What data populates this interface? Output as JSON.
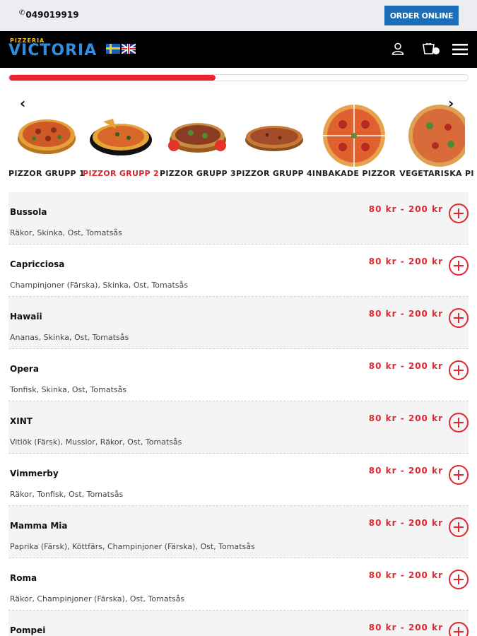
{
  "topbar": {
    "phone_icon": "phone-icon",
    "phone": "049019919",
    "order_online": "ORDER ONLINE"
  },
  "header": {
    "logo_small": "PIZZERIA",
    "logo_big": "VICTORIA",
    "languages": [
      "swedish-flag",
      "uk-flag"
    ],
    "icons": [
      "user-icon",
      "cart-icon",
      "menu-icon"
    ]
  },
  "progress": {
    "value": 0.45,
    "color": "#e8242f"
  },
  "categories": [
    {
      "label": "PIZZOR GRUPP 1",
      "active": false
    },
    {
      "label": "PIZZOR GRUPP 2",
      "active": true
    },
    {
      "label": "PIZZOR GRUPP 3",
      "active": false
    },
    {
      "label": "PIZZOR GRUPP 4",
      "active": false
    },
    {
      "label": "INBAKADE PIZZOR",
      "active": false
    },
    {
      "label": "VEGETARISKA PI",
      "active": false
    }
  ],
  "menu_items": [
    {
      "name": "Bussola",
      "desc": "Räkor, Skinka, Ost, Tomatsås",
      "price": "80 kr - 200 kr"
    },
    {
      "name": "Capricciosa",
      "desc": "Champinjoner (Färska), Skinka, Ost, Tomatsås",
      "price": "80 kr - 200 kr"
    },
    {
      "name": "Hawaii",
      "desc": "Ananas, Skinka, Ost, Tomatsås",
      "price": "80 kr - 200 kr"
    },
    {
      "name": "Opera",
      "desc": "Tonfisk, Skinka, Ost, Tomatsås",
      "price": "80 kr - 200 kr"
    },
    {
      "name": "XINT",
      "desc": "Vitlök (Färsk), Musslor, Räkor, Ost, Tomatsås",
      "price": "80 kr - 200 kr"
    },
    {
      "name": "Vimmerby",
      "desc": "Räkor, Tonfisk, Ost, Tomatsås",
      "price": "80 kr - 200 kr"
    },
    {
      "name": "Mamma Mia",
      "desc": "Paprika (Färsk), Köttfärs, Champinjoner (Färska), Ost, Tomatsås",
      "price": "80 kr - 200 kr"
    },
    {
      "name": "Roma",
      "desc": "Räkor, Champinjoner (Färska), Ost, Tomatsås",
      "price": "80 kr - 200 kr"
    },
    {
      "name": "Pompei",
      "desc": "",
      "price": "80 kr - 200 kr"
    }
  ],
  "colors": {
    "accent": "#e0262f",
    "order_button": "#1b6fb8",
    "header_bg": "#000000",
    "logo": "#2f8ee0"
  }
}
